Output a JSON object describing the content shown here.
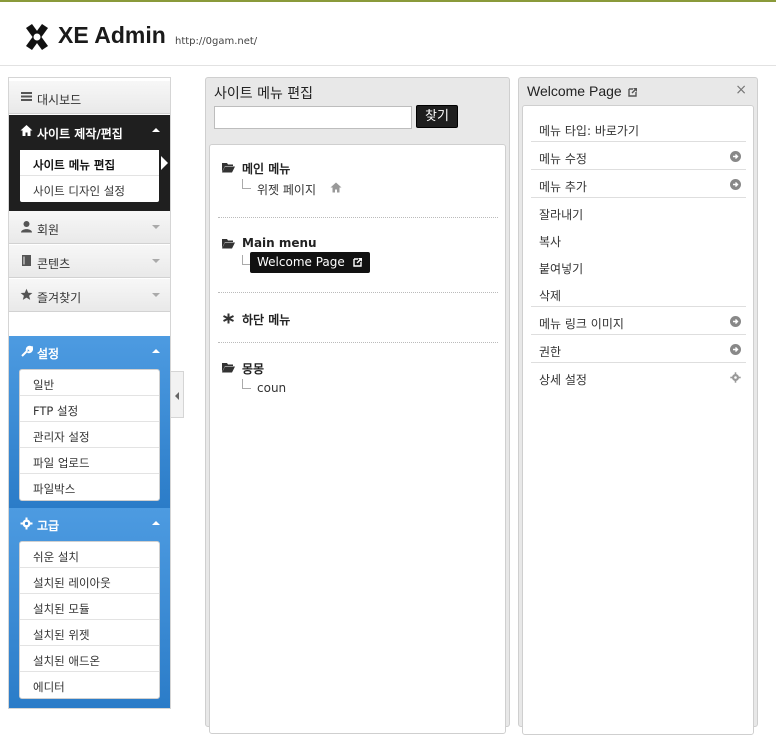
{
  "header": {
    "app_title": "XE Admin",
    "site_url": "http://0gam.net/"
  },
  "sidebar": {
    "dashboard": "대시보드",
    "site_build": {
      "label": "사이트 제작/편집",
      "items": [
        "사이트 메뉴 편집",
        "사이트 디자인 설정"
      ]
    },
    "members": "회원",
    "contents": "콘텐츠",
    "favorites": "즐겨찾기",
    "settings": {
      "label": "설정",
      "items": [
        "일반",
        "FTP 설정",
        "관리자 설정",
        "파일 업로드",
        "파일박스"
      ]
    },
    "advanced": {
      "label": "고급",
      "items": [
        "쉬운 설치",
        "설치된 레이아웃",
        "설치된 모듈",
        "설치된 위젯",
        "설치된 애드온",
        "에디터"
      ]
    }
  },
  "menu_panel": {
    "title": "사이트 메뉴 편집",
    "search_button": "찾기",
    "search_value": "",
    "groups": [
      {
        "name": "메인 메뉴",
        "children": [
          "위젯 페이지"
        ]
      },
      {
        "name": "Main menu",
        "children": [
          "Welcome Page"
        ]
      },
      {
        "name": "하단 메뉴",
        "children": []
      },
      {
        "name": "몽몽",
        "children": [
          "coun"
        ]
      }
    ]
  },
  "detail_panel": {
    "title": "Welcome Page",
    "close": "×",
    "rows": [
      "메뉴 타입: 바로가기",
      "메뉴 수정",
      "메뉴 추가",
      "잘라내기",
      "복사",
      "붙여넣기",
      "삭제",
      "메뉴 링크 이미지",
      "권한",
      "상세 설정"
    ]
  },
  "icons": {
    "accent_dark": "#1f1f1f",
    "accent_blue": "#3a8ad6"
  }
}
